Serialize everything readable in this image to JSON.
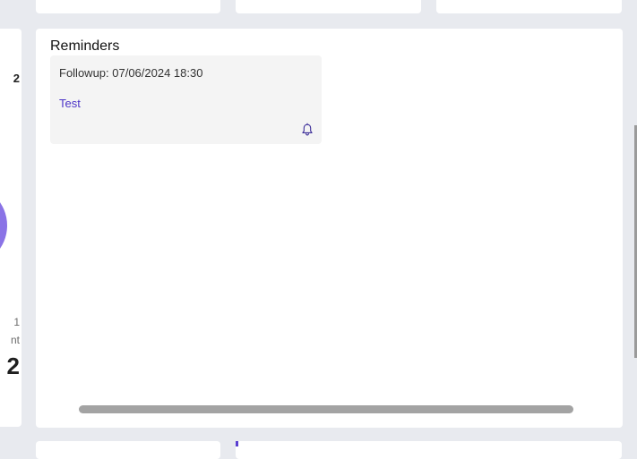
{
  "left_card": {
    "value_top": "2",
    "value_small": "1",
    "label_partial": "nt",
    "value_big": "2",
    "chart_color": "#8a73e6"
  },
  "reminders": {
    "title": "Reminders",
    "items": [
      {
        "followup": "Followup: 07/06/2024 18:30",
        "link_text": "Test",
        "icon": "bell-icon"
      }
    ]
  },
  "colors": {
    "background": "#e8eaef",
    "card": "#ffffff",
    "reminder_item_bg": "#f4f4f4",
    "link": "#4b33c7",
    "accent": "#5a3fd1"
  }
}
